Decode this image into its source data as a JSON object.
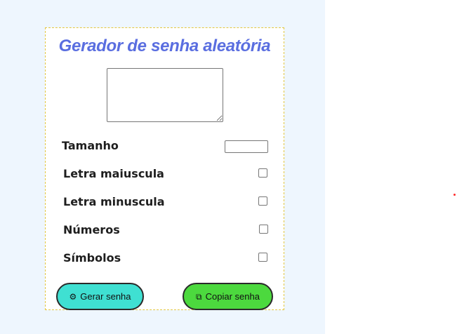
{
  "form": {
    "title": "Gerador de senha aleatória",
    "password_output": "",
    "length_label": "Tamanho",
    "length_value": "",
    "options": [
      {
        "label": "Letra maiuscula",
        "checked": false
      },
      {
        "label": "Letra minuscula",
        "checked": false
      },
      {
        "label": "Números",
        "checked": false
      },
      {
        "label": "Símbolos",
        "checked": false
      }
    ],
    "generate_button": {
      "icon": "gear-icon",
      "glyph": "⚙",
      "label": "Gerar senha"
    },
    "copy_button": {
      "icon": "copy-icon",
      "glyph": "⧉",
      "label": "Copiar senha"
    }
  },
  "colors": {
    "page_background": "#eef6fe",
    "title": "#5a6ee0",
    "card_border": "#e3c742",
    "generate_button": "#3fe0d2",
    "copy_button": "#4cd93e"
  }
}
